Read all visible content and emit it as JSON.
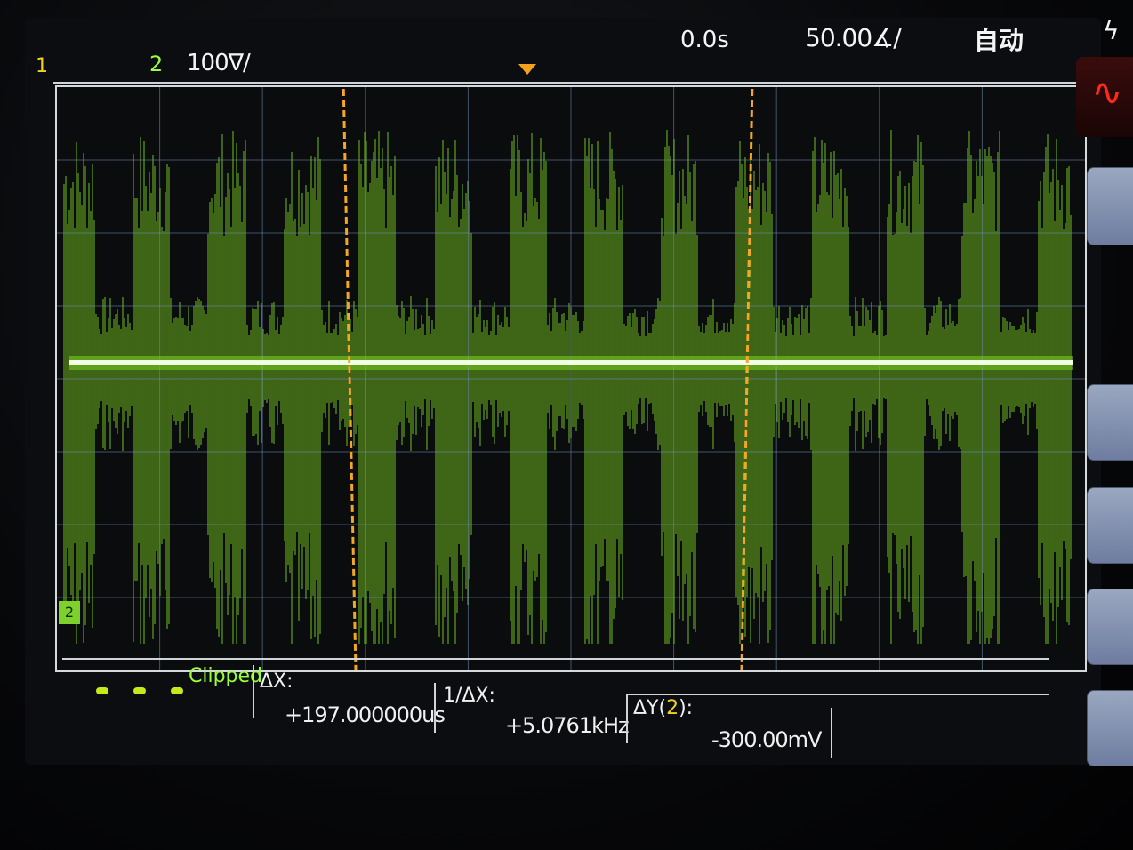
{
  "top": {
    "ch1_label": "1",
    "ch2_label": "2",
    "vdiv": "100∇/",
    "delay": "0.0s",
    "tdiv": "50.00∡/",
    "trigger_mode": "自动",
    "trigger_icon": "ϟ"
  },
  "ground_marker": "2",
  "measurements": {
    "clipped": "Clipped",
    "dx_label": "ΔX:",
    "dx_value": "+197.000000us",
    "inv_dx_label": "1/ΔX:",
    "inv_dx_value": "+5.0761kHz",
    "dy_label_prefix": "ΔY(",
    "dy_channel": "2",
    "dy_label_suffix": "):",
    "dy_value": "-300.00mV"
  },
  "colors": {
    "trace": "#7ed321",
    "cursor": "#f5a623",
    "channel1": "#f2d21c",
    "channel2": "#9aff3a"
  }
}
